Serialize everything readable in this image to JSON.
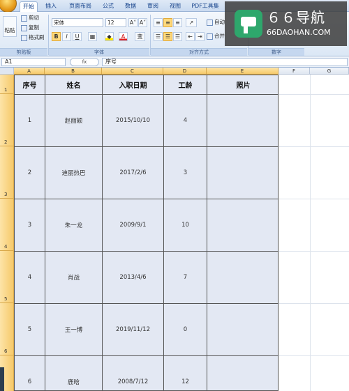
{
  "tabs": [
    "开始",
    "插入",
    "页面布局",
    "公式",
    "数据",
    "审阅",
    "视图",
    "PDF工具集"
  ],
  "ribbon": {
    "clipboard": {
      "paste": "粘贴",
      "cut": "剪切",
      "copy": "复制",
      "format_painter": "格式刷",
      "label": "剪贴板"
    },
    "font": {
      "name": "宋体",
      "size": "12",
      "bold": "B",
      "italic": "I",
      "underline": "U",
      "label": "字体",
      "grow": "A˄",
      "shrink": "A˅",
      "wen": "变"
    },
    "alignment": {
      "wrap": "自动",
      "merge": "合并",
      "label": "对齐方式"
    },
    "number": {
      "label": "数字"
    }
  },
  "formula_bar": {
    "name_box": "A1",
    "fx": "fx",
    "content": "序号"
  },
  "watermark": {
    "title": "６６导航",
    "subtitle": "66DAOHAN.COM"
  },
  "columns": [
    "A",
    "B",
    "C",
    "D",
    "E",
    "F",
    "G"
  ],
  "rows": [
    "1",
    "2",
    "3",
    "4",
    "5",
    "6"
  ],
  "table": {
    "headers": [
      "序号",
      "姓名",
      "入职日期",
      "工龄",
      "照片"
    ],
    "records": [
      [
        "1",
        "赵丽颖",
        "2015/10/10",
        "4",
        ""
      ],
      [
        "2",
        "迪丽热巴",
        "2017/2/6",
        "3",
        ""
      ],
      [
        "3",
        "朱一龙",
        "2009/9/1",
        "10",
        ""
      ],
      [
        "4",
        "肖战",
        "2013/4/6",
        "7",
        ""
      ],
      [
        "5",
        "王一博",
        "2019/11/12",
        "0",
        ""
      ],
      [
        "6",
        "鹿晗",
        "2008/7/12",
        "12",
        ""
      ]
    ]
  }
}
